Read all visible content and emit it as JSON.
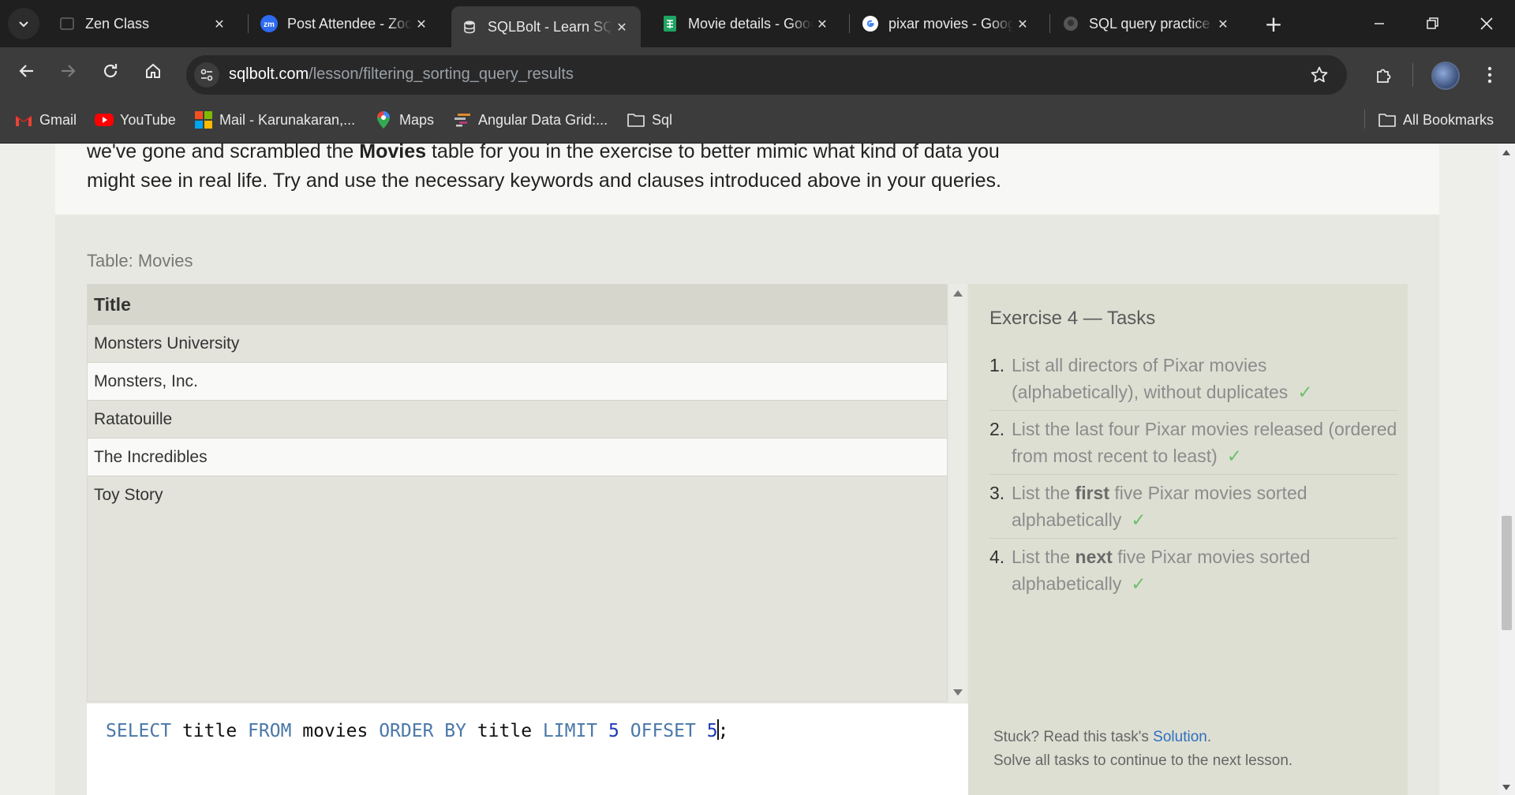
{
  "browser": {
    "tabs": [
      {
        "title": "Zen Class",
        "icon": "zen-class-favicon",
        "active": false
      },
      {
        "title": "Post Attendee - Zoom",
        "icon": "zoom-favicon",
        "active": false
      },
      {
        "title": "SQLBolt - Learn SQL",
        "icon": "sqlbolt-favicon",
        "active": true
      },
      {
        "title": "Movie details - Google Sheets",
        "icon": "google-sheets-favicon",
        "active": false
      },
      {
        "title": "pixar movies - Google Search",
        "icon": "google-favicon",
        "active": false
      },
      {
        "title": "SQL query practice",
        "icon": "github-favicon",
        "active": false
      }
    ],
    "zoom_badge": "zm",
    "url_host": "sqlbolt.com",
    "url_path": "/lesson/filtering_sorting_query_results",
    "bookmarks": [
      {
        "label": "Gmail",
        "icon": "gmail-icon"
      },
      {
        "label": "YouTube",
        "icon": "youtube-icon"
      },
      {
        "label": "Mail - Karunakaran,...",
        "icon": "microsoft-icon"
      },
      {
        "label": "Maps",
        "icon": "maps-icon"
      },
      {
        "label": "Angular Data Grid:...",
        "icon": "ag-grid-icon"
      },
      {
        "label": "Sql",
        "icon": "folder-icon"
      }
    ],
    "all_bookmarks": "All Bookmarks"
  },
  "lesson": {
    "line1_before": "we've gone and scrambled the ",
    "line1_bold": "Movies",
    "line1_after": " table for you in the exercise to better mimic what kind of data you",
    "line2": "might see in real life. Try and use the necessary keywords and clauses introduced above in your queries."
  },
  "exercise": {
    "table_caption": "Table: Movies",
    "column_header": "Title",
    "rows": [
      "Monsters University",
      "Monsters, Inc.",
      "Ratatouille",
      "The Incredibles",
      "Toy Story"
    ],
    "query": {
      "select": "SELECT",
      "col1": " title ",
      "from": "FROM",
      "table": " movies ",
      "order_by": "ORDER BY",
      "col2": " title ",
      "limit": "LIMIT",
      "limit_value": "5",
      "offset": "OFFSET",
      "offset_value": "5",
      "terminator": ";"
    }
  },
  "tasks": {
    "title": "Exercise 4 — Tasks",
    "items": [
      {
        "num": "1.",
        "before": "List all directors of Pixar movies (alphabetically), without duplicates",
        "bold": "",
        "after": "",
        "done": "✓"
      },
      {
        "num": "2.",
        "before": "List the last four Pixar movies released (ordered from most recent to least)",
        "bold": "",
        "after": "",
        "done": "✓"
      },
      {
        "num": "3.",
        "before": "List the ",
        "bold": "first",
        "after": " five Pixar movies sorted alphabetically",
        "done": "✓"
      },
      {
        "num": "4.",
        "before": "List the ",
        "bold": "next",
        "after": " five Pixar movies sorted alphabetically",
        "done": "✓"
      }
    ],
    "stuck_prefix": "Stuck? Read this task's ",
    "solution_link": "Solution",
    "stuck_suffix": ".",
    "continue_note": "Solve all tasks to continue to the next lesson."
  },
  "colors": {
    "chrome_dark": "#1f1f1f",
    "chrome_toolbar": "#3c3c3c",
    "page_bg": "#eeeeea",
    "keyword": "#4a78a8",
    "check": "#6cc06c",
    "link": "#2f6ebf"
  }
}
